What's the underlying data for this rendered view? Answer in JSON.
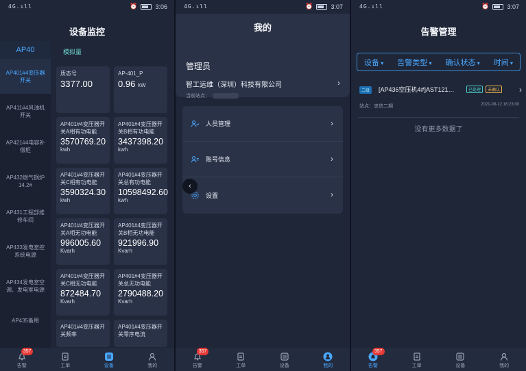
{
  "screen1": {
    "status": {
      "signal": "4G.ıll",
      "time": "3:06"
    },
    "title": "设备监控",
    "sidebar": {
      "header": "AP40",
      "items": [
        "AP401#4变压器开关",
        "AP411#4风油机开关",
        "AP421#4电容补偿柜",
        "AP432燃气锅炉14.2#",
        "AP431工程部维修车间",
        "AP433发电室控系统电源",
        "AP434发电室空调、发电室电源",
        "AP435备用"
      ]
    },
    "subtab": "模拟量",
    "cards": [
      {
        "label": "质态号",
        "value": "3377.00",
        "unit": ""
      },
      {
        "label": "AP-401_P",
        "value": "0.96",
        "unit": "kW"
      },
      {
        "label": "AP401#4变压器开关A相有功电能",
        "value": "3570769.20",
        "unit": "kwh"
      },
      {
        "label": "AP401#4变压器开关B相有功电能",
        "value": "3437398.20",
        "unit": "kwh"
      },
      {
        "label": "AP401#4变压器开关C相有功电能",
        "value": "3590324.30",
        "unit": "kwh"
      },
      {
        "label": "AP401#4变压器开关总有功电能",
        "value": "10598492.60",
        "unit": "kwh"
      },
      {
        "label": "AP401#4变压器开关A相无功电能",
        "value": "996005.60",
        "unit": "Kvarh"
      },
      {
        "label": "AP401#4变压器开关B相无功电能",
        "value": "921996.90",
        "unit": "Kvarh"
      },
      {
        "label": "AP401#4变压器开关C相无功电能",
        "value": "872484.70",
        "unit": "Kvarh"
      },
      {
        "label": "AP401#4变压器开关总无功电能",
        "value": "2790488.20",
        "unit": "Kvarh"
      },
      {
        "label": "AP401#4变压器开关频率",
        "value": "",
        "unit": ""
      },
      {
        "label": "AP401#4变压器开关零序电流",
        "value": "",
        "unit": ""
      }
    ]
  },
  "screen2": {
    "status": {
      "signal": "4G.ıll",
      "time": "3:07"
    },
    "title": "我的",
    "profile": {
      "name": "管理员",
      "company": "智工运维（深圳）科技有限公司",
      "site_label": "当前站点："
    },
    "menu": [
      "人员管理",
      "账号信息",
      "设置"
    ]
  },
  "screen3": {
    "status": {
      "signal": "4G.ıll",
      "time": "3:07"
    },
    "title": "告警管理",
    "filters": [
      "设备",
      "告警类型",
      "确认状态",
      "时间"
    ],
    "alarm": {
      "level": "二级",
      "title": "[AP436空压机4#]AST121…",
      "status_processed": "已处理",
      "status_unconfirmed": "未确认",
      "site": "站点：忠信二期",
      "time": "2021-08-12 16:23:00"
    },
    "no_more": "没有更多数据了"
  },
  "tabbar": {
    "badge": "357",
    "labels": [
      "告警",
      "工单",
      "设备",
      "我的"
    ]
  },
  "colors": {
    "accent": "#4aa8ff",
    "badge": "#e53935",
    "background": "#1f2638",
    "card": "#2a3247"
  }
}
